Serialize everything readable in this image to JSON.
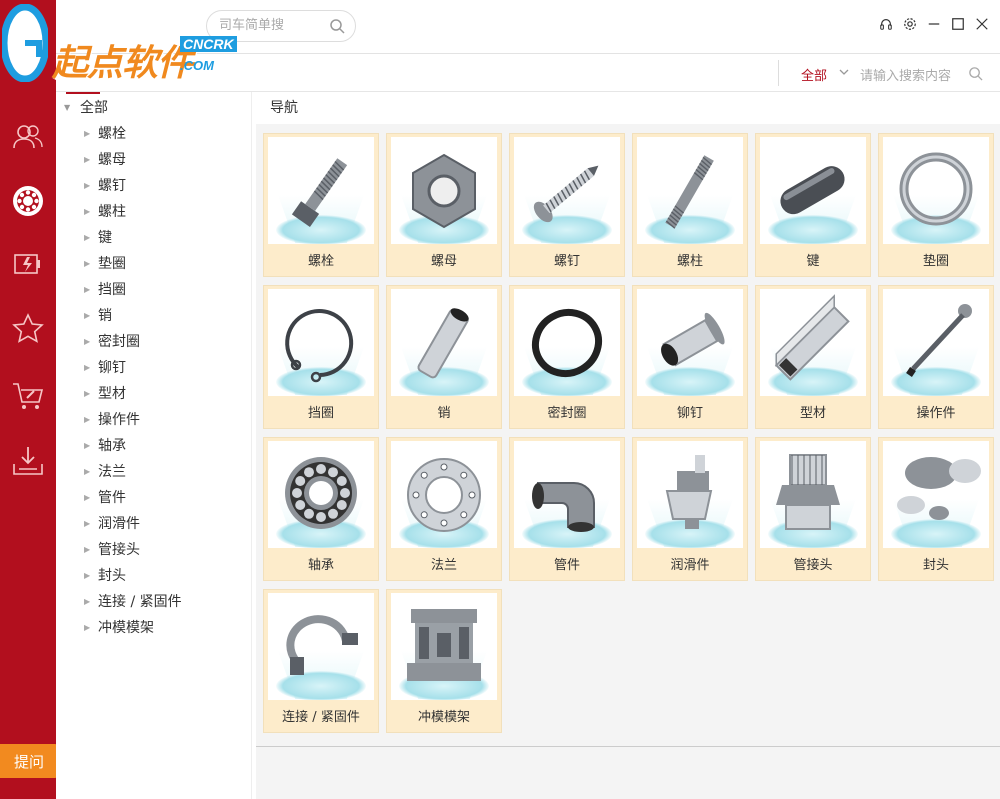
{
  "logo": {
    "text": "起点软件",
    "cn": "CNCRK",
    "com": ".COM"
  },
  "top": {
    "search_placeholder": "司车简单搜"
  },
  "window_controls": [
    "headset-icon",
    "gear-icon",
    "minimize-icon",
    "maximize-icon",
    "close-icon"
  ],
  "sidebar_rail": {
    "icons": [
      "users-icon",
      "bearing-icon",
      "battery-icon",
      "star-icon",
      "cart-tool-icon",
      "download-tray-icon"
    ],
    "ask_label": "提问"
  },
  "subbar": {
    "scope": "全部",
    "search_placeholder": "请输入搜索内容"
  },
  "tree": {
    "root": "全部",
    "items": [
      "螺栓",
      "螺母",
      "螺钉",
      "螺柱",
      "键",
      "垫圈",
      "挡圈",
      "销",
      "密封圈",
      "铆钉",
      "型材",
      "操作件",
      "轴承",
      "法兰",
      "管件",
      "润滑件",
      "管接头",
      "封头",
      "连接 / 紧固件",
      "冲模模架"
    ]
  },
  "main": {
    "breadcrumb": "导航",
    "cards": [
      "螺栓",
      "螺母",
      "螺钉",
      "螺柱",
      "键",
      "垫圈",
      "挡圈",
      "销",
      "密封圈",
      "铆钉",
      "型材",
      "操作件",
      "轴承",
      "法兰",
      "管件",
      "润滑件",
      "管接头",
      "封头",
      "连接 / 紧固件",
      "冲模模架"
    ]
  },
  "colors": {
    "rail": "#b20f1e",
    "accent_orange": "#f28a1f",
    "card_bg": "#fdeccb",
    "logo_orange": "#f0891e",
    "logo_blue": "#1e9de0"
  }
}
